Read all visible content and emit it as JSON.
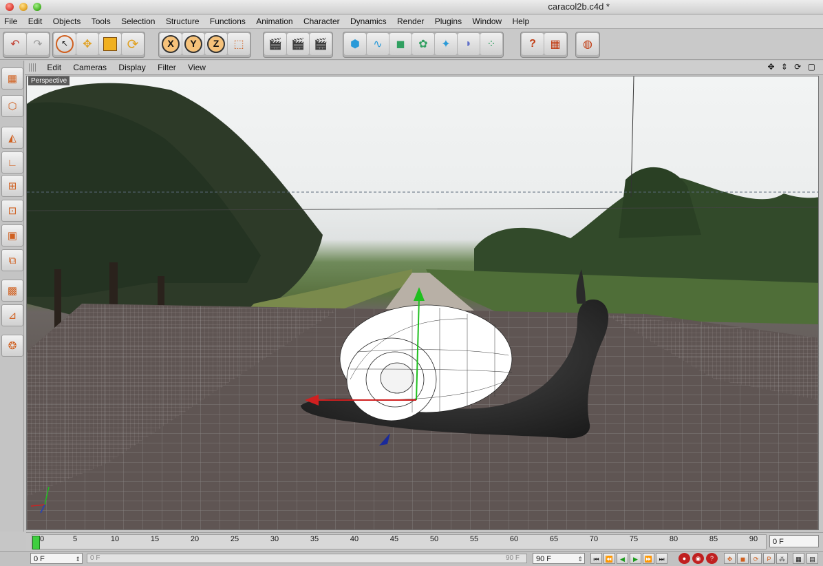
{
  "window": {
    "title": "caracol2b.c4d *"
  },
  "menu": [
    "File",
    "Edit",
    "Objects",
    "Tools",
    "Selection",
    "Structure",
    "Functions",
    "Animation",
    "Character",
    "Dynamics",
    "Render",
    "Plugins",
    "Window",
    "Help"
  ],
  "toolbar": {
    "undo_icon": "undo-icon",
    "redo_icon": "redo-icon",
    "axis_x": "X",
    "axis_y": "Y",
    "axis_z": "Z"
  },
  "viewport": {
    "menu": [
      "Edit",
      "Cameras",
      "Display",
      "Filter",
      "View"
    ],
    "label": "Perspective",
    "nav_icons": "✥ ⇕ ⟳ ▢",
    "accent": "#e07a2a"
  },
  "timeline": {
    "ticks": [
      "0",
      "5",
      "10",
      "15",
      "20",
      "25",
      "30",
      "35",
      "40",
      "45",
      "50",
      "55",
      "60",
      "65",
      "70",
      "75",
      "80",
      "85",
      "90"
    ],
    "current_frame": "0 F"
  },
  "bottombar": {
    "start_field": "0 F",
    "min_field": "0 F",
    "max_slider_label": "90 F",
    "end_field": "90 F"
  }
}
